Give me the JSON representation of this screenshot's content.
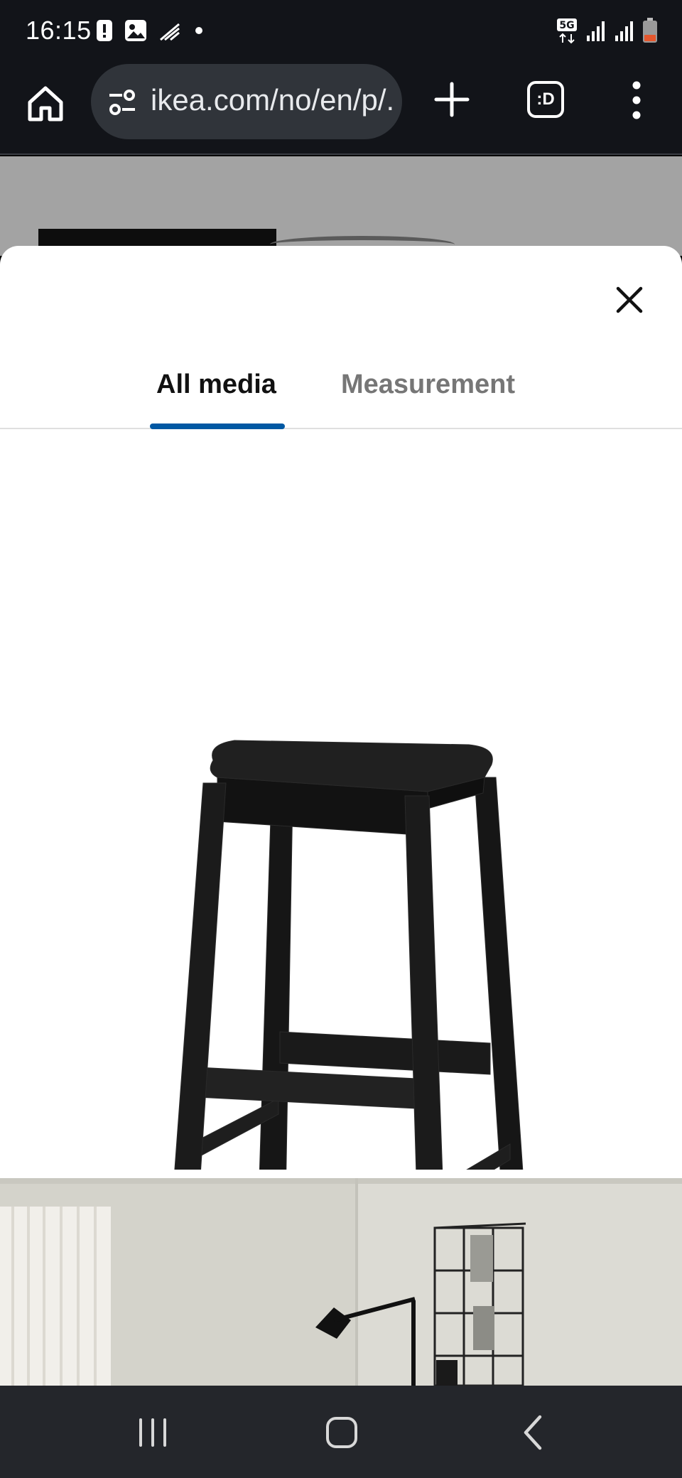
{
  "status_bar": {
    "time": "16:15",
    "icons": [
      "alert-icon",
      "image-icon",
      "signal-activity-icon",
      "dot-icon",
      "5g-icon",
      "signal-icon",
      "signal-icon",
      "battery-low-icon"
    ]
  },
  "browser": {
    "url": "ikea.com/no/en/p/...",
    "tabs_icon_label": ":D"
  },
  "modal": {
    "tabs": [
      {
        "label": "All media",
        "active": true
      },
      {
        "label": "Measurement",
        "active": false
      }
    ],
    "active_tab_color": "#0058a3"
  },
  "nav_bar": {
    "buttons": [
      "recents",
      "home",
      "back"
    ]
  }
}
